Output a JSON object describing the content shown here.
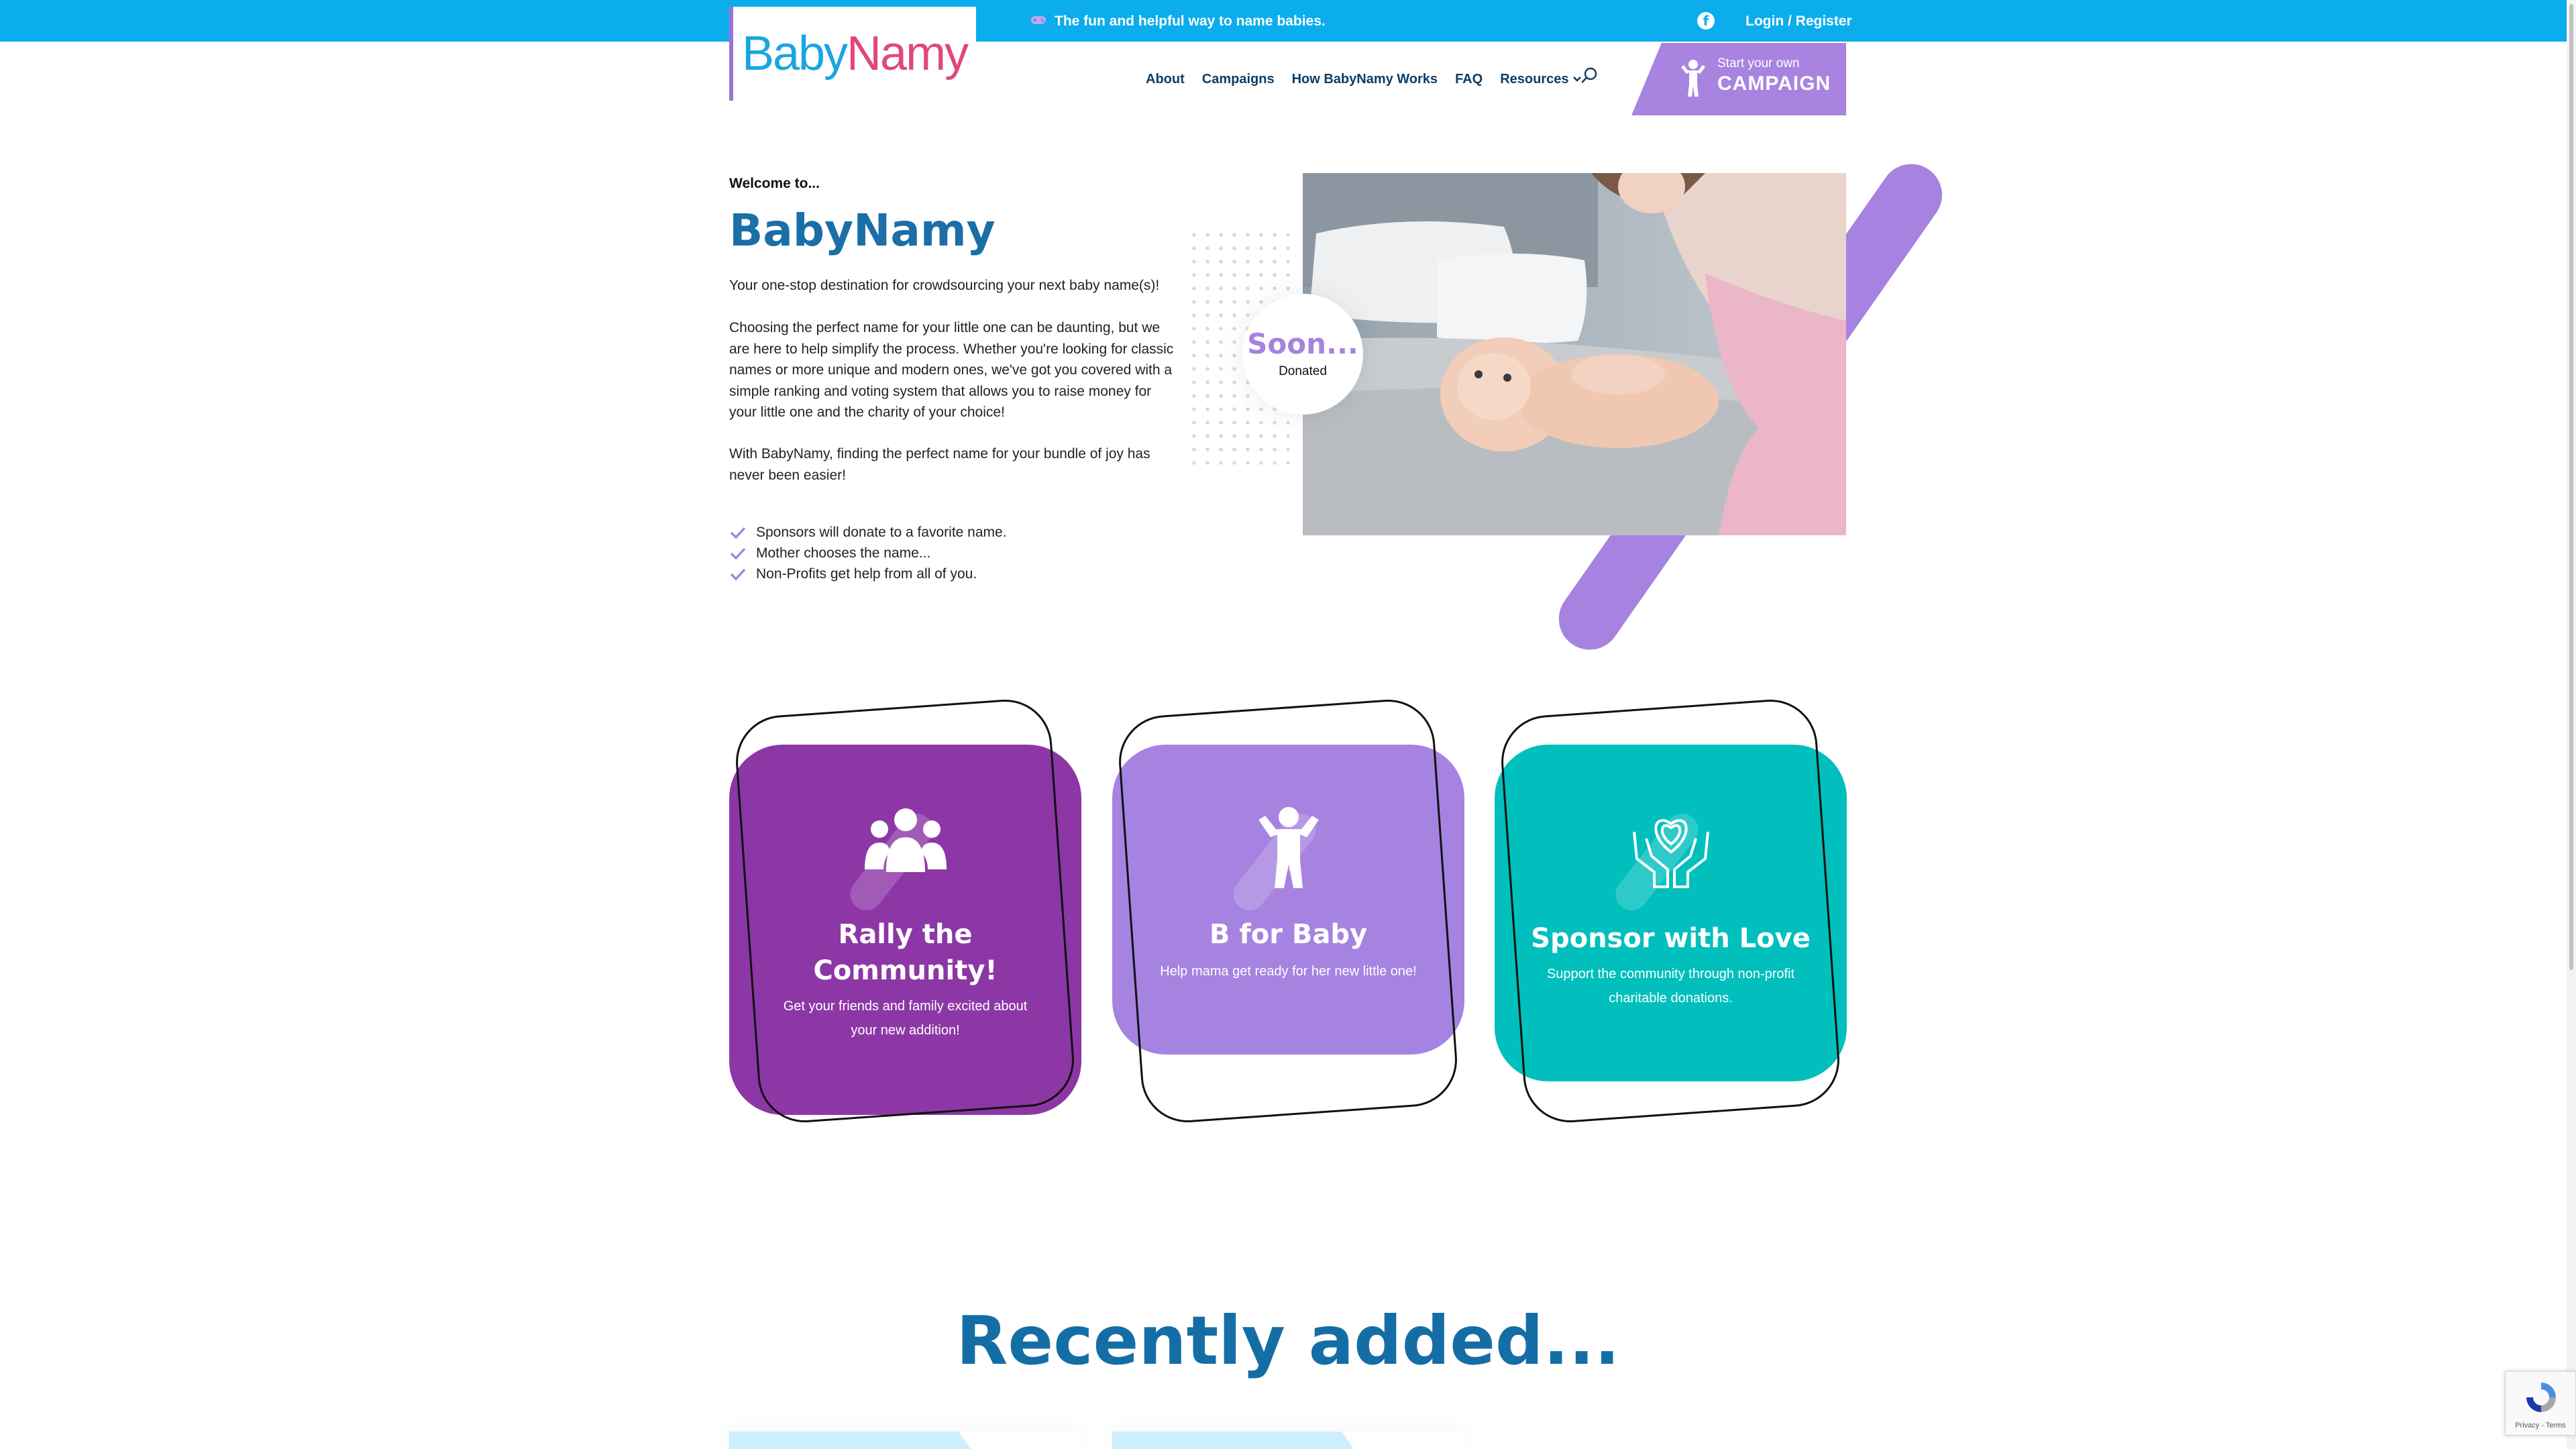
{
  "topbar": {
    "tagline": "The fun and helpful way to name babies.",
    "login": "Login / Register"
  },
  "logo": {
    "part1": "Baby",
    "part2": "Namy"
  },
  "nav": {
    "items": [
      "About",
      "Campaigns",
      "How BabyNamy Works",
      "FAQ",
      "Resources"
    ]
  },
  "campaign_button": {
    "small": "Start your own",
    "big": "CAMPAIGN"
  },
  "hero": {
    "welcome": "Welcome to...",
    "title": "BabyNamy",
    "p1": "Your one-stop destination for crowdsourcing your next baby name(s)!",
    "p2": "Choosing the perfect name for your little one can be daunting, but we are here to help simplify the process. Whether you're looking for classic names or more unique and modern ones, we've got you covered with a simple ranking and voting system that allows you to raise money for your little one and the charity of your choice!",
    "p3": "With BabyNamy, finding the perfect name for your bundle of joy has never been easier!",
    "checks": [
      "Sponsors will donate to a favorite name.",
      "Mother chooses the name...",
      "Non-Profits get help from all of you."
    ],
    "badge": {
      "value": "Soon...",
      "label": "Donated"
    }
  },
  "cards": [
    {
      "title": "Rally the Community!",
      "text": "Get your friends and family excited about your new addition!",
      "color": "#8d37a6",
      "icon": "community-icon"
    },
    {
      "title": "B for Baby",
      "text": "Help mama get ready for her new little one!",
      "color": "#a683e0",
      "icon": "baby-icon"
    },
    {
      "title": "Sponsor with Love",
      "text": "Support the community through non-profit charitable donations.",
      "color": "#00bfbd",
      "icon": "heart-hands-icon"
    }
  ],
  "recent": {
    "title": "Recently added..."
  },
  "recaptcha": {
    "label": "Privacy - Terms"
  }
}
